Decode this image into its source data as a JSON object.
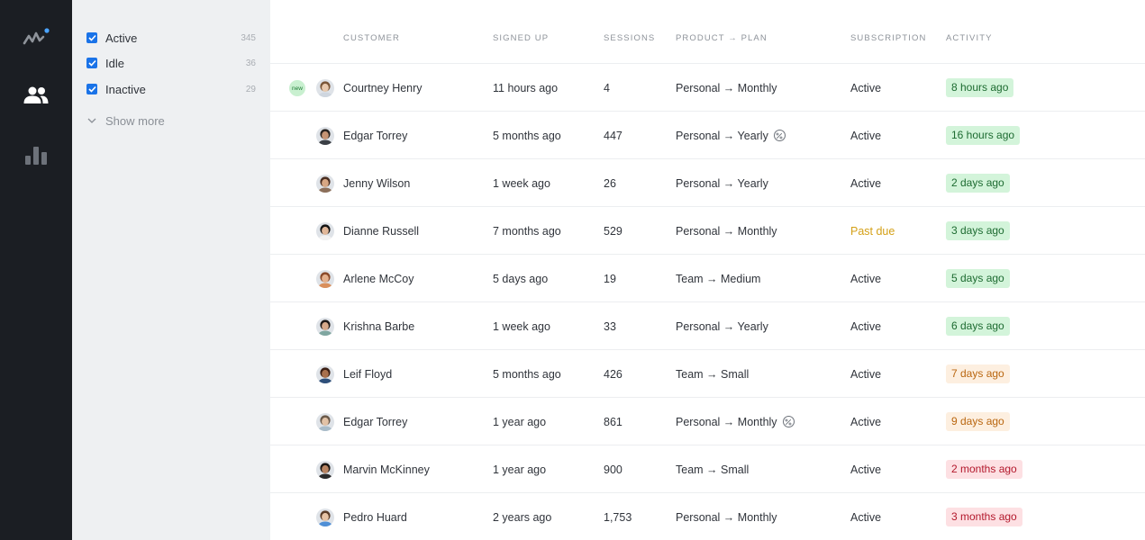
{
  "sidebar": {
    "icons": [
      "pulse-logo-icon",
      "people-icon",
      "bar-chart-icon"
    ],
    "accent_dot": "#4aa3ff"
  },
  "filters": {
    "items": [
      {
        "label": "Active",
        "count": "345",
        "checked": true
      },
      {
        "label": "Idle",
        "count": "36",
        "checked": true
      },
      {
        "label": "Inactive",
        "count": "29",
        "checked": true
      }
    ],
    "show_more": "Show more"
  },
  "table": {
    "headers": {
      "customer": "CUSTOMER",
      "signed_up": "SIGNED UP",
      "sessions": "SESSIONS",
      "product_plan": "PRODUCT → PLAN",
      "subscription": "SUBSCRIPTION",
      "activity": "ACTIVITY"
    },
    "new_badge": "new",
    "rows": [
      {
        "name": "Courtney Henry",
        "signed_up": "11 hours ago",
        "sessions": "4",
        "plan": "Personal → Monthly",
        "subscription": "Active",
        "activity": "8 hours ago",
        "activity_level": "green",
        "new": true,
        "discount": false,
        "skin": "#e8c9ae",
        "hair": "#7a5638",
        "shirt": "#cfd6df"
      },
      {
        "name": "Edgar Torrey",
        "signed_up": "5 months ago",
        "sessions": "447",
        "plan": "Personal → Yearly",
        "subscription": "Active",
        "activity": "16 hours ago",
        "activity_level": "green",
        "new": false,
        "discount": true,
        "skin": "#c59474",
        "hair": "#2a2522",
        "shirt": "#3b3f45"
      },
      {
        "name": "Jenny Wilson",
        "signed_up": "1 week ago",
        "sessions": "26",
        "plan": "Personal → Yearly",
        "subscription": "Active",
        "activity": "2 days ago",
        "activity_level": "green",
        "new": false,
        "discount": false,
        "skin": "#d7a784",
        "hair": "#4a2f22",
        "shirt": "#8c6f5a"
      },
      {
        "name": "Dianne Russell",
        "signed_up": "7 months ago",
        "sessions": "529",
        "plan": "Personal → Monthly",
        "subscription": "Past due",
        "activity": "3 days ago",
        "activity_level": "green",
        "new": false,
        "discount": false,
        "skin": "#e0b799",
        "hair": "#151515",
        "shirt": "#f2f2f2"
      },
      {
        "name": "Arlene McCoy",
        "signed_up": "5 days ago",
        "sessions": "19",
        "plan": "Team → Medium",
        "subscription": "Active",
        "activity": "5 days ago",
        "activity_level": "green",
        "new": false,
        "discount": false,
        "skin": "#e4b08c",
        "hair": "#8a4a2a",
        "shirt": "#d98f5c"
      },
      {
        "name": "Krishna Barbe",
        "signed_up": "1 week ago",
        "sessions": "33",
        "plan": "Personal → Yearly",
        "subscription": "Active",
        "activity": "6 days ago",
        "activity_level": "green",
        "new": false,
        "discount": false,
        "skin": "#d6a98a",
        "hair": "#1f1a18",
        "shirt": "#7fa6a0"
      },
      {
        "name": "Leif Floyd",
        "signed_up": "5 months ago",
        "sessions": "426",
        "plan": "Team → Small",
        "subscription": "Active",
        "activity": "7 days ago",
        "activity_level": "orange",
        "new": false,
        "discount": false,
        "skin": "#a8704d",
        "hair": "#3b1f14",
        "shirt": "#2e4f7a"
      },
      {
        "name": "Edgar Torrey",
        "signed_up": "1 year ago",
        "sessions": "861",
        "plan": "Personal → Monthly",
        "subscription": "Active",
        "activity": "9 days ago",
        "activity_level": "orange",
        "new": false,
        "discount": true,
        "skin": "#e2c2a6",
        "hair": "#6b5a4a",
        "shirt": "#a9bcc9"
      },
      {
        "name": "Marvin McKinney",
        "signed_up": "1 year ago",
        "sessions": "900",
        "plan": "Team → Small",
        "subscription": "Active",
        "activity": "2 months ago",
        "activity_level": "red",
        "new": false,
        "discount": false,
        "skin": "#b88462",
        "hair": "#1c1714",
        "shirt": "#2b2b2b"
      },
      {
        "name": "Pedro Huard",
        "signed_up": "2 years ago",
        "sessions": "1,753",
        "plan": "Personal → Monthly",
        "subscription": "Active",
        "activity": "3 months ago",
        "activity_level": "red",
        "new": false,
        "discount": false,
        "skin": "#e6c3a5",
        "hair": "#5a3c28",
        "shirt": "#4f8fd6"
      }
    ]
  },
  "colors": {
    "rail_bg": "#1b1e23",
    "filter_bg": "#eef0f2",
    "checkbox": "#1a73e8",
    "past_due": "#d4a017",
    "activity_green": "#d3f4da",
    "activity_orange": "#fdefe0",
    "activity_red": "#fde0e3"
  }
}
